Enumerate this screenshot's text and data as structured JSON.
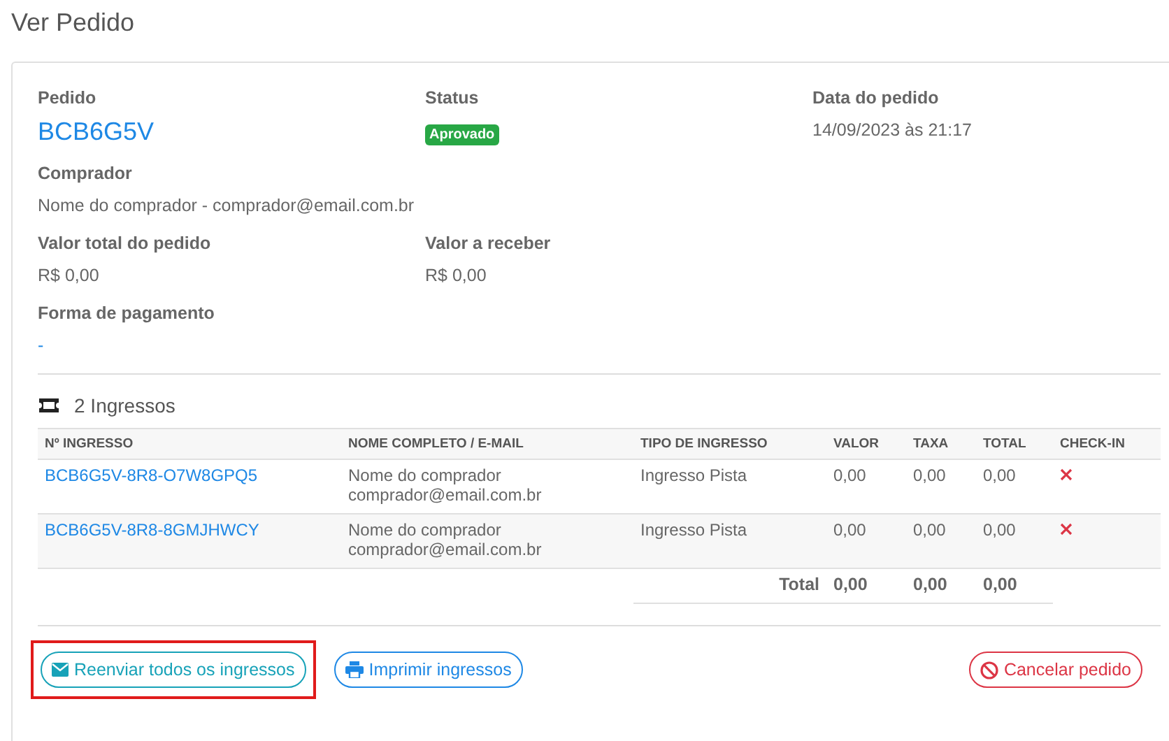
{
  "page_title": "Ver Pedido",
  "order": {
    "label": "Pedido",
    "code": "BCB6G5V"
  },
  "status": {
    "label": "Status",
    "badge": "Aprovado",
    "kind": "approved"
  },
  "date": {
    "label": "Data do pedido",
    "value": "14/09/2023 às 21:17"
  },
  "buyer": {
    "label": "Comprador",
    "value": "Nome do comprador - comprador@email.com.br"
  },
  "total": {
    "label": "Valor total do pedido",
    "value": "R$ 0,00"
  },
  "receivable": {
    "label": "Valor a receber",
    "value": "R$ 0,00"
  },
  "payment": {
    "label": "Forma de pagamento",
    "value": "-"
  },
  "tickets_heading": "2 Ingressos",
  "table": {
    "columns": [
      "Nº INGRESSO",
      "NOME COMPLETO / E-MAIL",
      "TIPO DE INGRESSO",
      "VALOR",
      "TAXA",
      "TOTAL",
      "CHECK-IN"
    ],
    "rows": [
      {
        "code": "BCB6G5V-8R8-O7W8GPQ5",
        "name": "Nome do comprador",
        "email": "comprador@email.com.br",
        "type": "Ingresso Pista",
        "value": "0,00",
        "fee": "0,00",
        "total": "0,00",
        "checked_in": false
      },
      {
        "code": "BCB6G5V-8R8-8GMJHWCY",
        "name": "Nome do comprador",
        "email": "comprador@email.com.br",
        "type": "Ingresso Pista",
        "value": "0,00",
        "fee": "0,00",
        "total": "0,00",
        "checked_in": false
      }
    ],
    "totals": {
      "label": "Total",
      "value": "0,00",
      "fee": "0,00",
      "total": "0,00"
    }
  },
  "buttons": [
    {
      "label": "Reenviar todos os ingressos",
      "kind": "resend",
      "highlighted": true
    },
    {
      "label": "Imprimir ingressos",
      "kind": "print",
      "highlighted": false
    },
    {
      "label": "Cancelar pedido",
      "kind": "cancel",
      "highlighted": false
    }
  ]
}
